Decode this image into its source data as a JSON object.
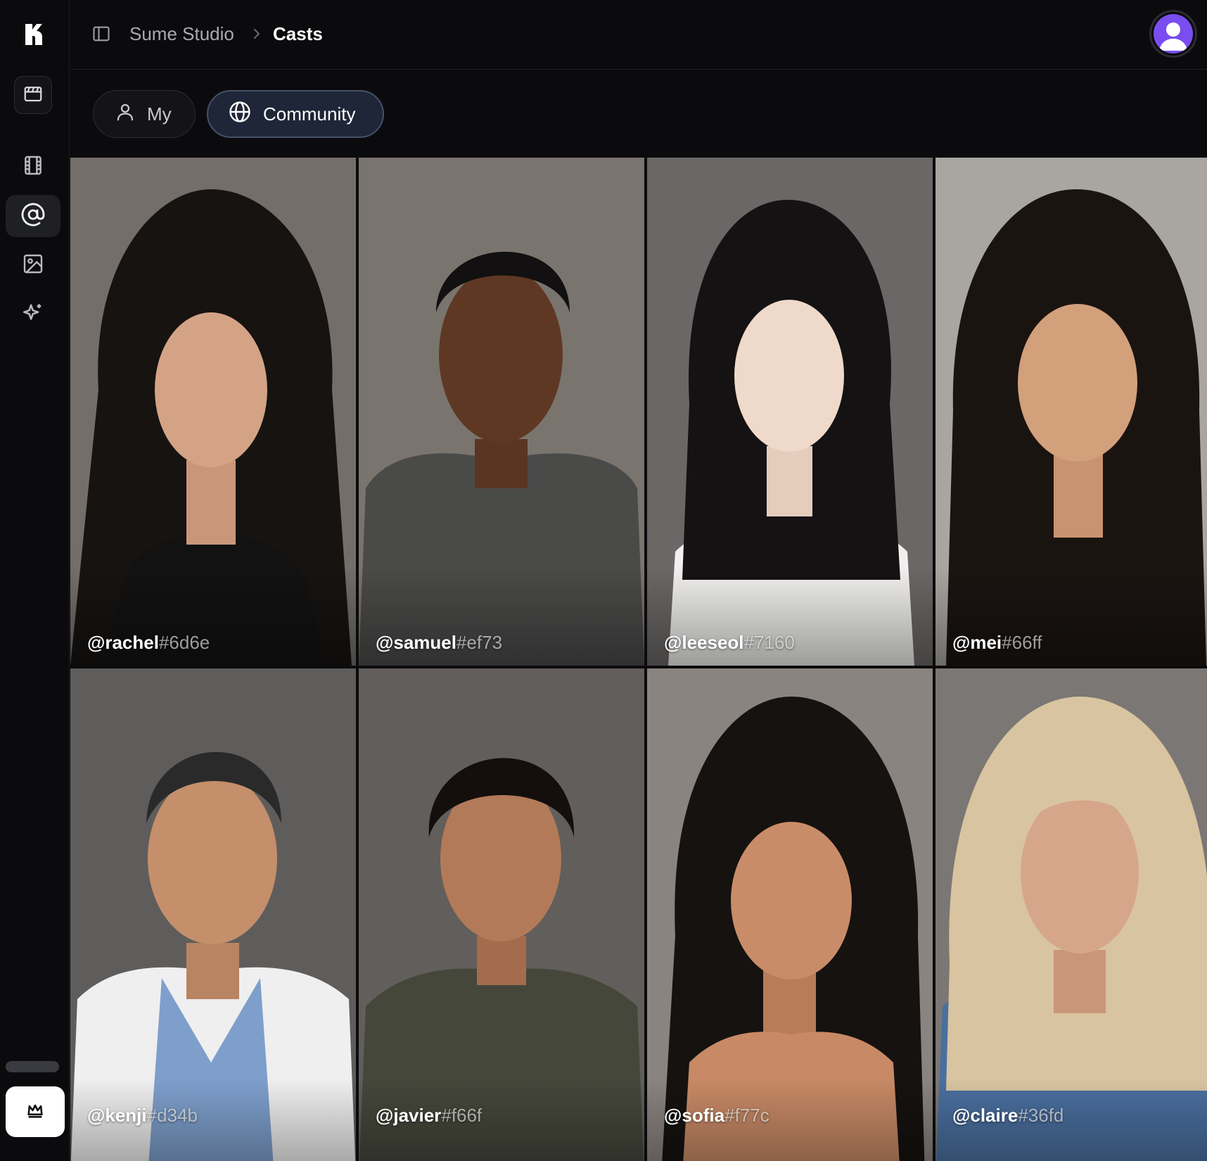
{
  "breadcrumb": {
    "studio": "Sume Studio",
    "separator": "›",
    "current": "Casts"
  },
  "tabs": [
    {
      "label": "My",
      "icon": "user-icon",
      "selected": false
    },
    {
      "label": "Community",
      "icon": "globe-icon",
      "selected": true
    }
  ],
  "sidebar": {
    "items": [
      {
        "icon": "clapperboard-icon"
      },
      {
        "icon": "film-icon"
      },
      {
        "icon": "at-sign-icon",
        "active": true
      },
      {
        "icon": "image-icon"
      },
      {
        "icon": "sparkles-icon"
      }
    ],
    "bottom_icon": "crown-icon"
  },
  "colors": {
    "accent": "#7a4df0",
    "active_tab_bg": "#1f2638",
    "background": "#0b0b0d"
  },
  "casts": [
    {
      "name": "@rachel",
      "id": "#6d6e"
    },
    {
      "name": "@samuel",
      "id": "#ef73"
    },
    {
      "name": "@leeseol",
      "id": "#7160"
    },
    {
      "name": "@mei",
      "id": "#66ff"
    },
    {
      "name": "@kenji",
      "id": "#d34b"
    },
    {
      "name": "@javier",
      "id": "#f66f"
    },
    {
      "name": "@sofia",
      "id": "#f77c"
    },
    {
      "name": "@claire",
      "id": "#36fd"
    }
  ]
}
